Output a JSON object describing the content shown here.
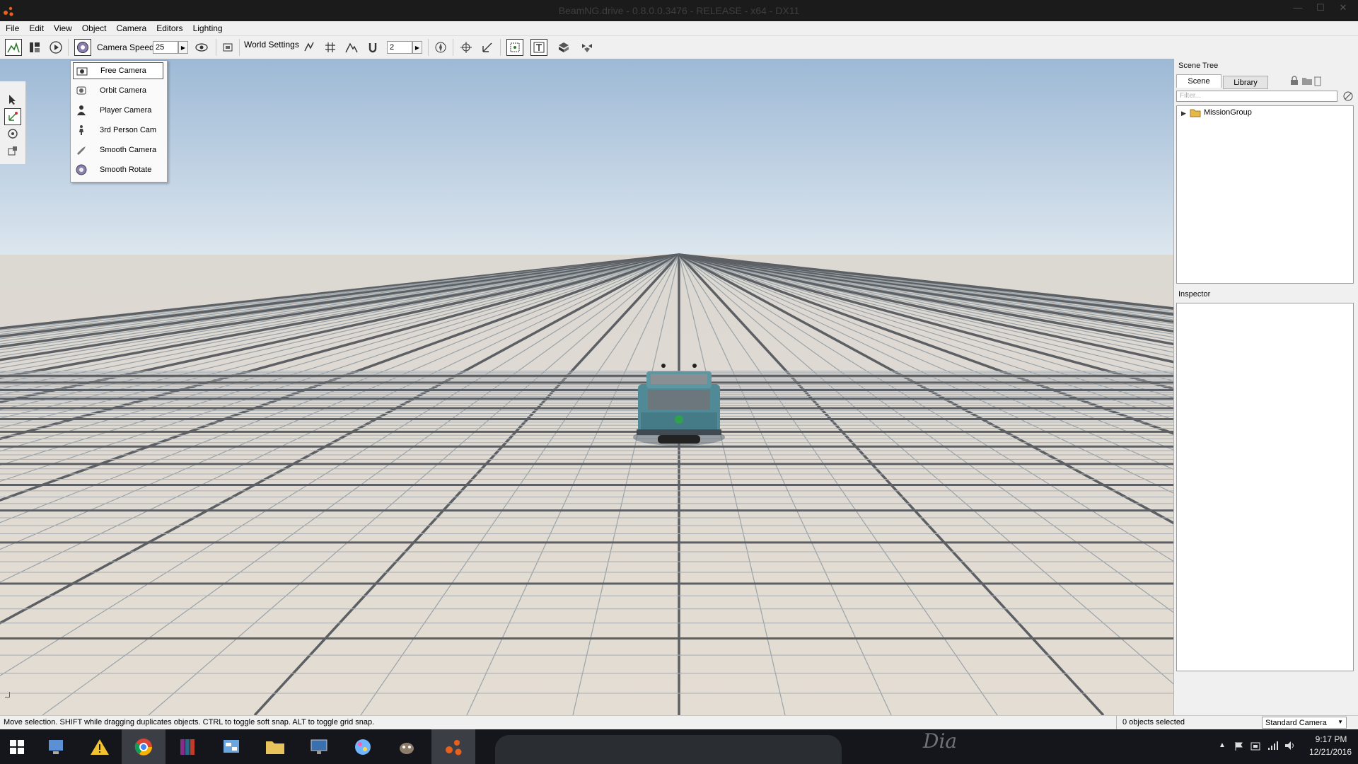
{
  "window": {
    "title": "BeamNG.drive - 0.8.0.0.3476 - RELEASE - x64 - DX11"
  },
  "menubar": {
    "items": [
      "File",
      "Edit",
      "View",
      "Object",
      "Camera",
      "Editors",
      "Lighting"
    ]
  },
  "toolbar": {
    "camera_speed_label": "Camera Speed",
    "camera_speed_value": "25",
    "world_settings_label": "World Settings",
    "snap_value": "2"
  },
  "camera_menu": {
    "items": [
      {
        "label": "Free Camera",
        "icon": "camera-icon",
        "selected": true
      },
      {
        "label": "Orbit Camera",
        "icon": "orbit-camera-icon"
      },
      {
        "label": "Player Camera",
        "icon": "player-icon"
      },
      {
        "label": "3rd Person Cam",
        "icon": "person-icon"
      },
      {
        "label": "Smooth Camera",
        "icon": "smooth-camera-icon"
      },
      {
        "label": "Smooth Rotate",
        "icon": "smooth-rotate-icon"
      }
    ]
  },
  "scene_tree": {
    "title": "Scene Tree",
    "tabs": [
      "Scene",
      "Library"
    ],
    "filter_placeholder": "Filter...",
    "nodes": [
      "MissionGroup"
    ]
  },
  "inspector": {
    "title": "Inspector"
  },
  "statusbar": {
    "message": "Move selection.  SHIFT while dragging duplicates objects.  CTRL to toggle soft snap.  ALT to toggle grid snap.",
    "selection": "0 objects selected",
    "camera_mode": "Standard Camera"
  },
  "taskbar": {
    "time": "9:17 PM",
    "date": "12/21/2016",
    "background_text": "Dia"
  },
  "colors": {
    "sky_top": "#9db9d6",
    "sky_horizon": "#dce6ee",
    "ground": "#e2ddd5",
    "vehicle": "#4f8a96",
    "taskbar": "#14161b"
  }
}
